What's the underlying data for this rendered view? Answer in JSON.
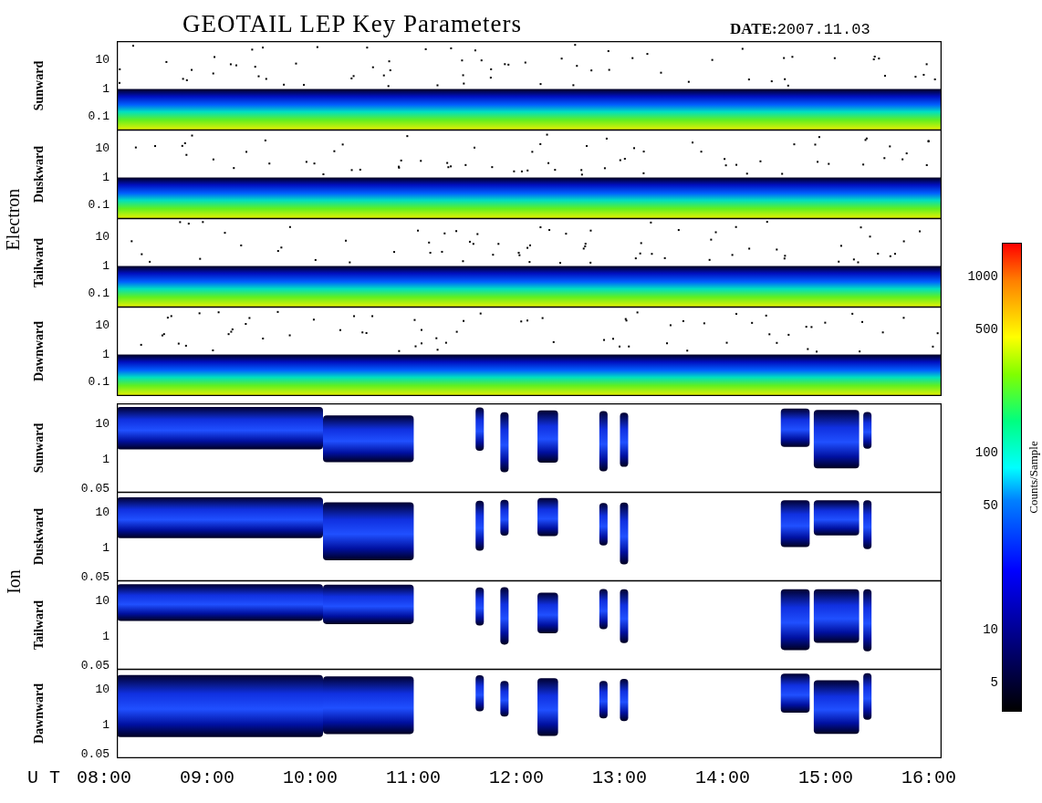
{
  "title": "GEOTAIL LEP Key Parameters",
  "date": "**DATE:**2007.11.03",
  "groups": [
    {
      "name": "Electron",
      "kind": "electron",
      "panels": [
        {
          "direction": "Sunward",
          "yticks": [
            "10",
            "1",
            "0.1"
          ]
        },
        {
          "direction": "Duskward",
          "yticks": [
            "10",
            "1",
            "0.1"
          ]
        },
        {
          "direction": "Tailward",
          "yticks": [
            "10",
            "1",
            "0.1"
          ]
        },
        {
          "direction": "Dawnward",
          "yticks": [
            "10",
            "1",
            "0.1"
          ]
        }
      ]
    },
    {
      "name": "Ion",
      "kind": "ion",
      "panels": [
        {
          "direction": "Sunward",
          "yticks": [
            "10",
            "1",
            "0.05"
          ]
        },
        {
          "direction": "Duskward",
          "yticks": [
            "10",
            "1",
            "0.05"
          ]
        },
        {
          "direction": "Tailward",
          "yticks": [
            "10",
            "1",
            "0.05"
          ]
        },
        {
          "direction": "Dawnward",
          "yticks": [
            "10",
            "1",
            "0.05"
          ]
        }
      ]
    }
  ],
  "time_axis": {
    "label": "U T",
    "ticks": [
      "08:00",
      "09:00",
      "10:00",
      "11:00",
      "12:00",
      "13:00",
      "14:00",
      "15:00",
      "16:00"
    ]
  },
  "colorbar": {
    "title": "Counts/Sample",
    "ticks": [
      "1000",
      "500",
      "100",
      "50",
      "10",
      "5"
    ]
  }
}
